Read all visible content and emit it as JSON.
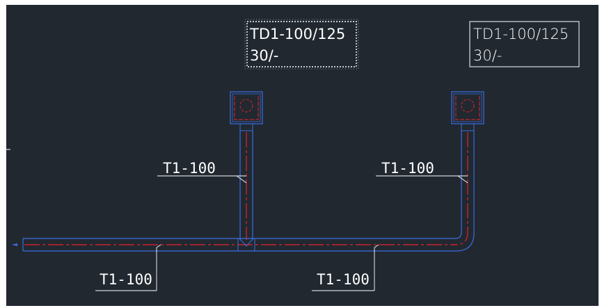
{
  "drawing": {
    "background": "#212830",
    "colors": {
      "pipe_outline": "#3a6fe0",
      "centerline": "#c8222c",
      "text": "#ffffff",
      "selection_border": "#ffffff"
    },
    "tags": [
      {
        "line1": "TD1-100/125",
        "line2": "30/-",
        "selected": true
      },
      {
        "line1": "TD1-100/125",
        "line2": "30/-",
        "selected": false
      }
    ],
    "pipe_labels": [
      {
        "text": "T1-100"
      },
      {
        "text": "T1-100"
      },
      {
        "text": "T1-100"
      },
      {
        "text": "T1-100"
      }
    ],
    "drains": [
      {
        "icon": "floor-drain-icon"
      },
      {
        "icon": "floor-drain-icon"
      }
    ]
  }
}
